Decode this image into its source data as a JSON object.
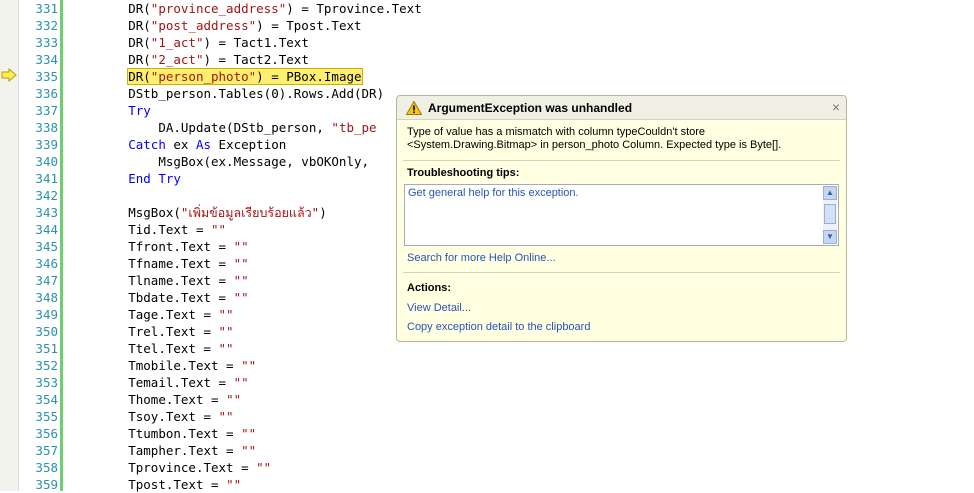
{
  "line_numbers": [
    "331",
    "332",
    "333",
    "334",
    "335",
    "336",
    "337",
    "338",
    "339",
    "340",
    "341",
    "342",
    "343",
    "344",
    "345",
    "346",
    "347",
    "348",
    "349",
    "350",
    "351",
    "352",
    "353",
    "354",
    "355",
    "356",
    "357",
    "358",
    "359"
  ],
  "code": {
    "l331": {
      "a": "DR(",
      "b": "\"province_address\"",
      "c": ") = Tprovince.Text"
    },
    "l332": {
      "a": "DR(",
      "b": "\"post_address\"",
      "c": ") = Tpost.Text"
    },
    "l333": {
      "a": "DR(",
      "b": "\"1_act\"",
      "c": ") = Tact1.Text"
    },
    "l334": {
      "a": "DR(",
      "b": "\"2_act\"",
      "c": ") = Tact2.Text"
    },
    "l335": {
      "a": "DR(",
      "b": "\"person_photo\"",
      "c": ") = PBox.Image"
    },
    "l336": "DStb_person.Tables(0).Rows.Add(DR)",
    "l337": "Try",
    "l338": {
      "a": "    DA.Update(DStb_person, ",
      "b": "\"tb_pe"
    },
    "l339": {
      "kw1": "Catch",
      "a": " ex ",
      "kw2": "As",
      "b": " Exception"
    },
    "l340": "    MsgBox(ex.Message, vbOKOnly,",
    "l341": "End Try",
    "l343": {
      "a": "MsgBox(",
      "b": "\"เพิ่มข้อมูลเรียบร้อยแล้ว\"",
      "c": ")"
    },
    "l344": {
      "a": "Tid.Text = ",
      "b": "\"\""
    },
    "l345": {
      "a": "Tfront.Text = ",
      "b": "\"\""
    },
    "l346": {
      "a": "Tfname.Text = ",
      "b": "\"\""
    },
    "l347": {
      "a": "Tlname.Text = ",
      "b": "\"\""
    },
    "l348": {
      "a": "Tbdate.Text = ",
      "b": "\"\""
    },
    "l349": {
      "a": "Tage.Text = ",
      "b": "\"\""
    },
    "l350": {
      "a": "Trel.Text = ",
      "b": "\"\""
    },
    "l351": {
      "a": "Ttel.Text = ",
      "b": "\"\""
    },
    "l352": {
      "a": "Tmobile.Text = ",
      "b": "\"\""
    },
    "l353": {
      "a": "Temail.Text = ",
      "b": "\"\""
    },
    "l354": {
      "a": "Thome.Text = ",
      "b": "\"\""
    },
    "l355": {
      "a": "Tsoy.Text = ",
      "b": "\"\""
    },
    "l356": {
      "a": "Ttumbon.Text = ",
      "b": "\"\""
    },
    "l357": {
      "a": "Tampher.Text = ",
      "b": "\"\""
    },
    "l358": {
      "a": "Tprovince.Text = ",
      "b": "\"\""
    },
    "l359": {
      "a": "Tpost.Text = ",
      "b": "\"\""
    }
  },
  "exception": {
    "title": "ArgumentException was unhandled",
    "message": "Type of value has a mismatch with column typeCouldn't store <System.Drawing.Bitmap> in person_photo Column.  Expected type is Byte[].",
    "tips_heading": "Troubleshooting tips:",
    "tip_item": "Get general help for this exception.",
    "search_link": "Search for more Help Online...",
    "actions_heading": "Actions:",
    "view_detail": "View Detail...",
    "copy_detail": "Copy exception detail to the clipboard",
    "close_glyph": "×"
  },
  "colors": {
    "keyword": "#0000ff",
    "string": "#a31515",
    "line_number": "#2b91af",
    "highlight": "#ffef6e",
    "popup_bg": "#ffffe1",
    "link": "#2a53b5"
  }
}
